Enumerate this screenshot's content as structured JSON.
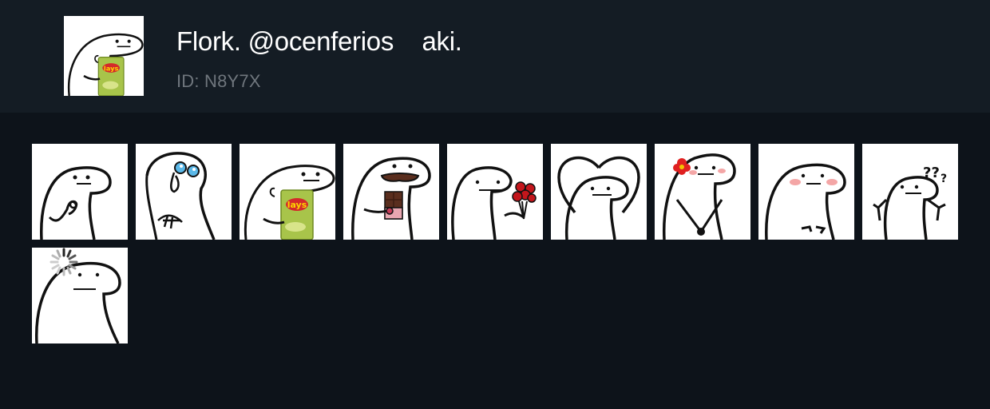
{
  "pack": {
    "title": "Flork. @ocenferios    aki.",
    "id_label": "ID: N8Y7X",
    "thumbnail_icon": "flork-chips-icon"
  },
  "stickers": [
    {
      "icon": "flork-ok-hand-icon"
    },
    {
      "icon": "flork-teary-eyes-icon"
    },
    {
      "icon": "flork-chips-icon"
    },
    {
      "icon": "flork-chocolate-icon"
    },
    {
      "icon": "flork-roses-icon"
    },
    {
      "icon": "flork-heart-icon"
    },
    {
      "icon": "flork-flower-blush-icon"
    },
    {
      "icon": "flork-blush-icon"
    },
    {
      "icon": "flork-confused-icon"
    },
    {
      "icon": "flork-loading-icon"
    }
  ],
  "colors": {
    "background": "#0d131a",
    "header_background": "#141c24",
    "title_text": "#ffffff",
    "id_text": "#6f767d",
    "chips_bag": "#a8c44a",
    "chocolate": "#5a2e1e",
    "rose": "#c3161c",
    "blush": "#f4a6a6"
  }
}
